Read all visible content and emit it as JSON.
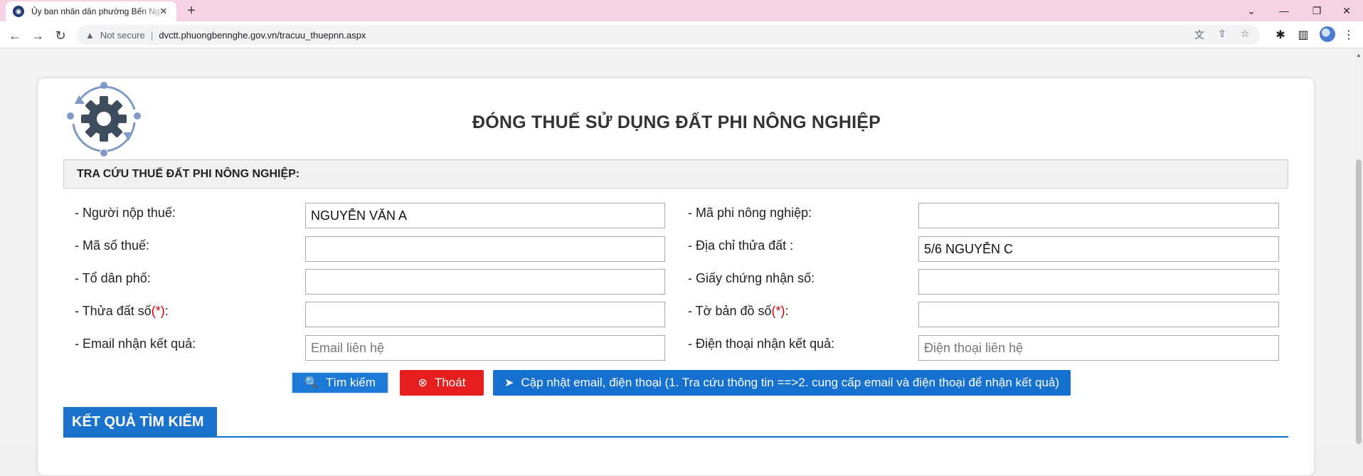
{
  "browser": {
    "tab_title": "Ủy ban nhân dân phường Bến Nghé",
    "favicon_glyph": "◉",
    "close_glyph": "✕",
    "new_tab_glyph": "+",
    "window_controls": {
      "dropdown": "⌄",
      "minimize": "—",
      "restore": "❐",
      "close": "✕"
    },
    "nav": {
      "back": "←",
      "forward": "→",
      "reload": "↻"
    },
    "security_icon": "▲",
    "security_text": "Not secure",
    "url": "dvctt.phuongbennghe.gov.vn/tracuu_thuepnn.aspx",
    "omnibox_icons": [
      "translate-icon",
      "share-icon",
      "bookmark-star-icon"
    ],
    "omnibox_glyphs": {
      "translate": "文",
      "share": "⇪",
      "star": "☆"
    },
    "toolbar_glyphs": {
      "extensions": "✱",
      "sidepanel": "▥",
      "menu": "⋮"
    }
  },
  "page": {
    "title": "ĐÓNG THUẾ SỬ DỤNG ĐẤT PHI NÔNG NGHIỆP",
    "section_title": "TRA CỨU THUẾ ĐẤT PHI NÔNG NGHIỆP:",
    "required_marker": "(*)",
    "form": {
      "left": [
        {
          "label": "- Người nộp thuế:",
          "value": "NGUYỄN VĂN A",
          "placeholder": "",
          "required": false
        },
        {
          "label": "- Mã số thuế:",
          "value": "",
          "placeholder": "",
          "required": false
        },
        {
          "label": "- Tổ dân phố:",
          "value": "",
          "placeholder": "",
          "required": false
        },
        {
          "label": "- Thửa đất số",
          "value": "",
          "placeholder": "",
          "required": true
        },
        {
          "label": "- Email nhận kết quả:",
          "value": "",
          "placeholder": "Email liên hệ",
          "required": false
        }
      ],
      "right": [
        {
          "label": "- Mã phi nông nghiệp:",
          "value": "",
          "placeholder": "",
          "required": false
        },
        {
          "label": "- Địa chỉ thửa đất :",
          "value": "5/6 NGUYỄN C",
          "placeholder": "",
          "required": false
        },
        {
          "label": "- Giấy chứng nhận số:",
          "value": "",
          "placeholder": "",
          "required": false
        },
        {
          "label": "- Tờ bản đồ số",
          "value": "",
          "placeholder": "",
          "required": true
        },
        {
          "label": "- Điện thoại nhận kết quả:",
          "value": "",
          "placeholder": "Điện thoại liên hệ",
          "required": false
        }
      ]
    },
    "buttons": {
      "search": "Tìm kiếm",
      "exit": "Thoát",
      "update": "Cập nhật email, điện thoại (1. Tra cứu thông tin ==>2. cung cấp email và điện thoại để nhận kết quả)"
    },
    "button_glyphs": {
      "search": "🔍",
      "exit": "⊗",
      "update": "➤"
    },
    "results_title": "KẾT QUẢ TÌM KIẾM"
  },
  "colors": {
    "tabstrip": "#f6d3e4",
    "primary_blue": "#1a72cc",
    "exit_red": "#e61e1e",
    "required_red": "#d00000",
    "logo_gear": "#3e4d5e",
    "logo_ring": "#7f9ac4"
  }
}
